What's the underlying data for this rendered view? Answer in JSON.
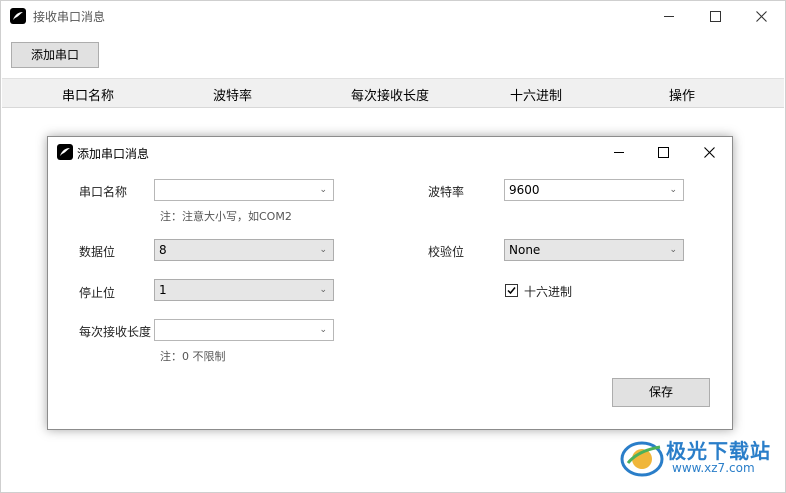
{
  "main_window": {
    "title": "接收串口消息",
    "add_button": "添加串口",
    "columns": [
      "串口名称",
      "波特率",
      "每次接收长度",
      "十六进制",
      "操作"
    ]
  },
  "dialog": {
    "title": "添加串口消息",
    "fields": {
      "port_name": {
        "label": "串口名称",
        "value": "",
        "note": "注：注意大小写，如COM2"
      },
      "baud_rate": {
        "label": "波特率",
        "value": "9600"
      },
      "data_bits": {
        "label": "数据位",
        "value": "8"
      },
      "parity": {
        "label": "校验位",
        "value": "None"
      },
      "stop_bits": {
        "label": "停止位",
        "value": "1"
      },
      "hex": {
        "label": "十六进制",
        "checked": true
      },
      "receive_length": {
        "label": "每次接收长度",
        "value": "",
        "note": "注：0 不限制"
      }
    },
    "save_button": "保存"
  },
  "watermark": {
    "name": "极光下载站",
    "url": "www.xz7.com"
  },
  "icons": {
    "app": "feather-icon",
    "minimize": "minimize-icon",
    "maximize": "maximize-icon",
    "close": "close-icon",
    "dropdown": "chevron-down-icon",
    "check": "checkmark-icon"
  },
  "colors": {
    "watermark_blue": "#2a7ec9"
  }
}
